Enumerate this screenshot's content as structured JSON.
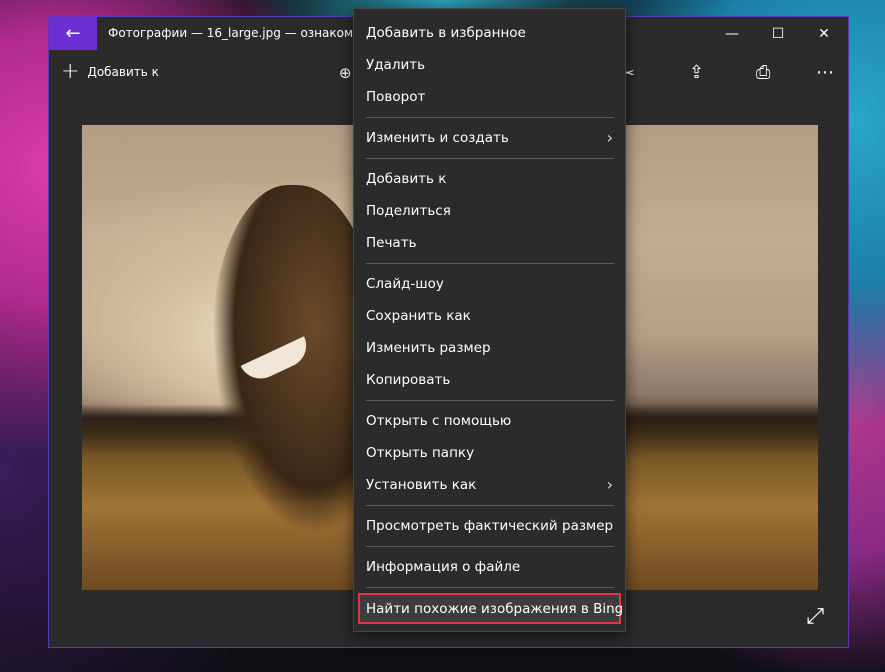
{
  "window": {
    "title": "Фотографии — 16_large.jpg — ознакомительный просмотр",
    "controls": [
      "—",
      "☐",
      "✕"
    ],
    "accent_color": "#6b2fd3"
  },
  "toolbar": {
    "add_label": "Добавить к"
  },
  "menu": {
    "items": [
      "Добавить в избранное",
      "Удалить",
      "Поворот",
      "Изменить и создать",
      "Добавить к",
      "Поделиться",
      "Печать",
      "Слайд-шоу",
      "Сохранить как",
      "Изменить размер",
      "Копировать",
      "Открыть с помощью",
      "Открыть папку",
      "Установить как",
      "Просмотреть фактический размер",
      "Информация о файле",
      "Найти похожие изображения в Bing"
    ],
    "highlight_color": "#e0383b"
  }
}
